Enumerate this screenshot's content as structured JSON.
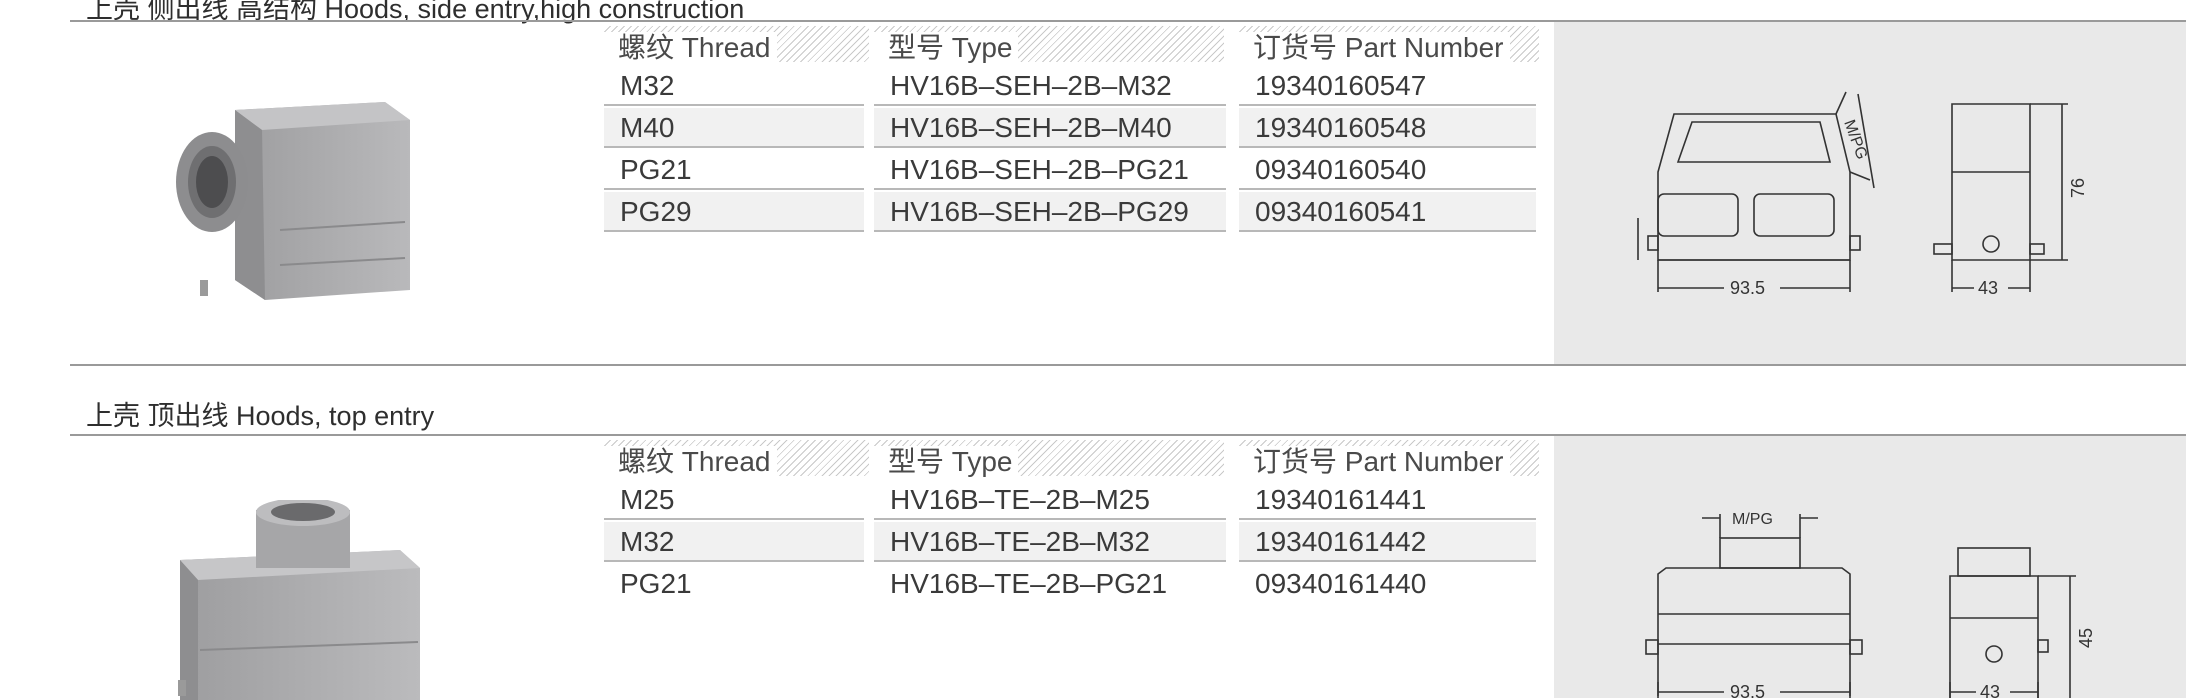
{
  "section1": {
    "title": "上壳 侧出线 高结构 Hoods, side entry,high construction",
    "headers": {
      "thread": "螺纹 Thread",
      "type": "型号 Type",
      "part": "订货号 Part Number"
    },
    "rows": [
      {
        "thread": "M32",
        "type": "HV16B–SEH–2B–M32",
        "part": "19340160547"
      },
      {
        "thread": "M40",
        "type": "HV16B–SEH–2B–M40",
        "part": "19340160548"
      },
      {
        "thread": "PG21",
        "type": "HV16B–SEH–2B–PG21",
        "part": "09340160540"
      },
      {
        "thread": "PG29",
        "type": "HV16B–SEH–2B–PG29",
        "part": "09340160541"
      }
    ],
    "dims": {
      "width": "93.5",
      "depth": "43",
      "height": "76",
      "thread": "M/PG"
    }
  },
  "section2": {
    "title": "上壳 顶出线  Hoods, top entry",
    "headers": {
      "thread": "螺纹 Thread",
      "type": "型号 Type",
      "part": "订货号 Part Number"
    },
    "rows": [
      {
        "thread": "M25",
        "type": "HV16B–TE–2B–M25",
        "part": "19340161441"
      },
      {
        "thread": "M32",
        "type": "HV16B–TE–2B–M32",
        "part": "19340161442"
      },
      {
        "thread": "PG21",
        "type": "HV16B–TE–2B–PG21",
        "part": "09340161440"
      }
    ],
    "dims": {
      "width": "93.5",
      "depth": "43",
      "height": "45",
      "thread": "M/PG"
    }
  }
}
